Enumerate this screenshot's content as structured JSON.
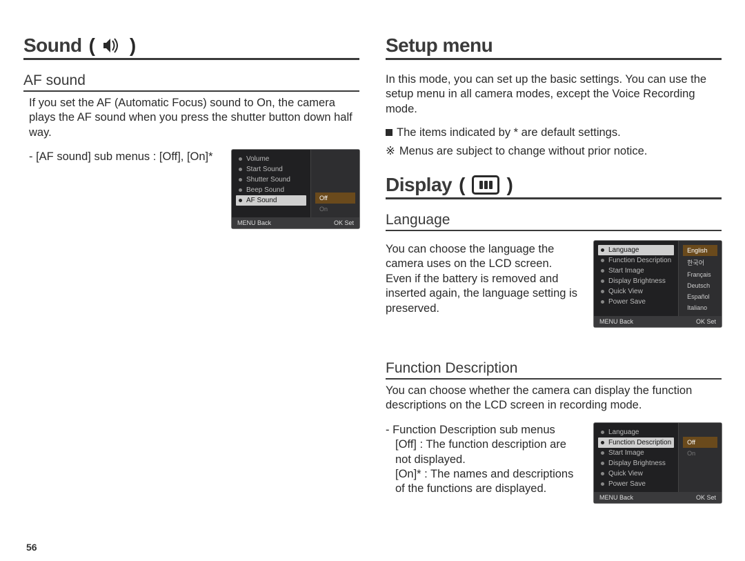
{
  "page_number": "56",
  "left": {
    "heading": "Sound",
    "section": {
      "title": "AF sound",
      "desc": "If you set the AF (Automatic Focus) sound to On, the camera plays the AF sound when you press the shutter button down half way.",
      "submenu_line": "- [AF sound] sub menus : [Off], [On]*",
      "lcd": {
        "items": [
          "Volume",
          "Start Sound",
          "Shutter Sound",
          "Beep Sound",
          "AF Sound"
        ],
        "selected_index": 4,
        "options": [
          "Off",
          "On"
        ],
        "option_highlight_index": 0,
        "footer_left": "MENU Back",
        "footer_right": "OK Set"
      }
    }
  },
  "right": {
    "setup": {
      "heading": "Setup menu",
      "desc": "In this mode, you can set up the basic settings. You can use the setup menu in all camera modes, except the Voice Recording mode.",
      "bullet1": "The items indicated by * are default settings.",
      "bullet2": "Menus are subject to change without prior notice.",
      "bullet2_mark": "※"
    },
    "display": {
      "heading": "Display",
      "language": {
        "title": "Language",
        "desc": "You can choose the language the camera uses on the LCD screen. Even if the battery is removed and inserted again, the language setting is preserved.",
        "lcd": {
          "items": [
            "Language",
            "Function Description",
            "Start Image",
            "Display Brightness",
            "Quick View",
            "Power Save"
          ],
          "selected_index": 0,
          "options": [
            "English",
            "한국어",
            "Français",
            "Deutsch",
            "Español",
            "Italiano"
          ],
          "option_highlight_index": 0,
          "footer_left": "MENU Back",
          "footer_right": "OK Set"
        }
      },
      "func": {
        "title": "Function Description",
        "desc": "You can choose whether the camera can display the function descriptions on the LCD screen in recording mode.",
        "sub_intro": "- Function Description sub menus",
        "sub_off": "[Off]  : The function description are not displayed.",
        "sub_on": "[On]* : The names and descriptions of the functions are displayed.",
        "lcd": {
          "items": [
            "Language",
            "Function Description",
            "Start Image",
            "Display Brightness",
            "Quick View",
            "Power Save"
          ],
          "selected_index": 1,
          "options": [
            "Off",
            "On"
          ],
          "option_highlight_index": 0,
          "footer_left": "MENU Back",
          "footer_right": "OK Set"
        }
      }
    }
  }
}
